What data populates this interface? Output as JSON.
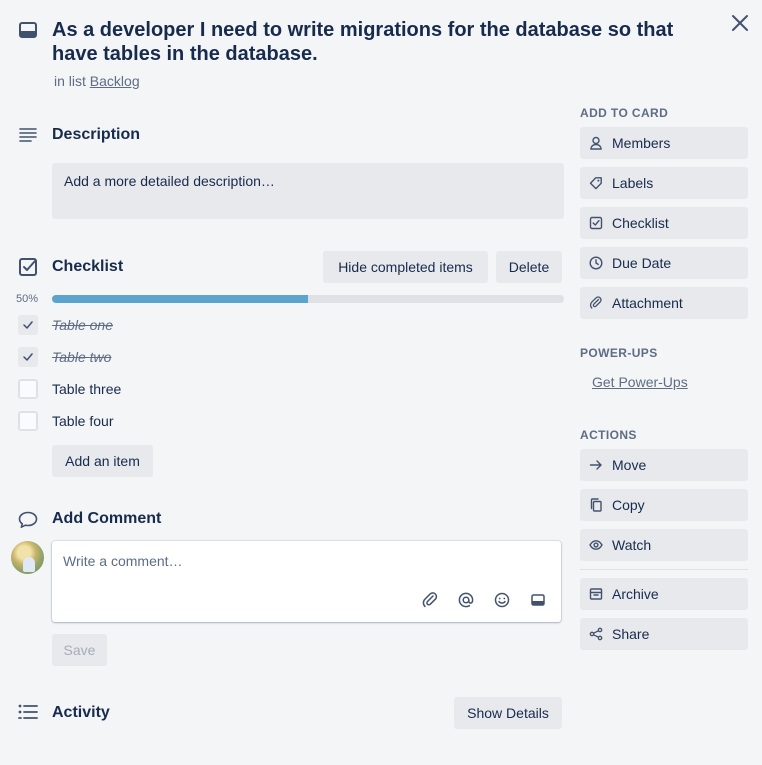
{
  "card": {
    "title": "As a developer I need to write migrations for the database so that have tables in the database.",
    "in_list_prefix": "in list",
    "list_name": "Backlog"
  },
  "description": {
    "heading": "Description",
    "placeholder": "Add a more detailed description…"
  },
  "checklist": {
    "heading": "Checklist",
    "hide_label": "Hide completed items",
    "delete_label": "Delete",
    "percent_text": "50%",
    "progress": 0.5,
    "items": [
      {
        "label": "Table one",
        "checked": true
      },
      {
        "label": "Table two",
        "checked": true
      },
      {
        "label": "Table three",
        "checked": false
      },
      {
        "label": "Table four",
        "checked": false
      }
    ],
    "add_item_label": "Add an item"
  },
  "comment": {
    "heading": "Add Comment",
    "placeholder": "Write a comment…",
    "save_label": "Save",
    "tools": [
      "paperclip-icon",
      "at-mention-icon",
      "emoji-icon",
      "card-icon"
    ]
  },
  "activity": {
    "heading": "Activity",
    "details_label": "Show Details"
  },
  "sidebar": {
    "add_to_card_label": "ADD TO CARD",
    "add_to_card": [
      {
        "label": "Members",
        "icon": "person-icon"
      },
      {
        "label": "Labels",
        "icon": "tag-icon"
      },
      {
        "label": "Checklist",
        "icon": "checkbox-icon"
      },
      {
        "label": "Due Date",
        "icon": "clock-icon"
      },
      {
        "label": "Attachment",
        "icon": "paperclip-icon"
      }
    ],
    "powerups_label": "POWER-UPS",
    "get_powerups": "Get Power-Ups",
    "actions_label": "ACTIONS",
    "actions": [
      {
        "label": "Move",
        "icon": "arrow-right-icon"
      },
      {
        "label": "Copy",
        "icon": "copy-icon"
      },
      {
        "label": "Watch",
        "icon": "eye-icon"
      }
    ],
    "actions_more": [
      {
        "label": "Archive",
        "icon": "archive-icon"
      },
      {
        "label": "Share",
        "icon": "share-icon"
      }
    ]
  },
  "colors": {
    "background": "#f4f5f7",
    "button": "#e8e9ec",
    "progress": "#5ba4cf",
    "text": "#172b4d",
    "muted": "#5e6c84"
  }
}
